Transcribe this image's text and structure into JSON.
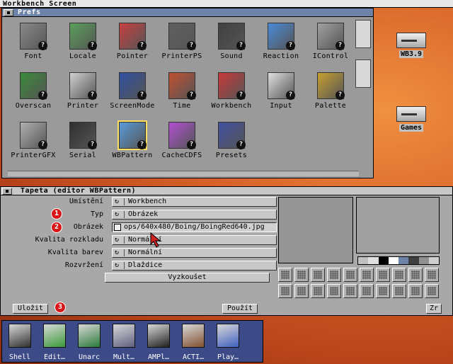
{
  "screen": {
    "title": "Workbench Screen"
  },
  "prefs_window": {
    "title": "Prefs",
    "icons": [
      {
        "label": "Font",
        "icon": "font-icon"
      },
      {
        "label": "Locale",
        "icon": "locale-icon"
      },
      {
        "label": "Pointer",
        "icon": "pointer-icon"
      },
      {
        "label": "PrinterPS",
        "icon": "printerps-icon"
      },
      {
        "label": "Sound",
        "icon": "sound-icon"
      },
      {
        "label": "Reaction",
        "icon": "reaction-icon"
      },
      {
        "label": "IControl",
        "icon": "icontrol-icon"
      },
      {
        "label": "Overscan",
        "icon": "overscan-icon"
      },
      {
        "label": "Printer",
        "icon": "printer-icon"
      },
      {
        "label": "ScreenMode",
        "icon": "screenmode-icon"
      },
      {
        "label": "Time",
        "icon": "time-icon"
      },
      {
        "label": "Workbench",
        "icon": "workbench-icon"
      },
      {
        "label": "Input",
        "icon": "input-icon"
      },
      {
        "label": "Palette",
        "icon": "palette-icon"
      },
      {
        "label": "PrinterGFX",
        "icon": "printergfx-icon"
      },
      {
        "label": "Serial",
        "icon": "serial-icon"
      },
      {
        "label": "WBPattern",
        "icon": "wbpattern-icon",
        "selected": true
      },
      {
        "label": "CacheCDFS",
        "icon": "cachecdfs-icon"
      },
      {
        "label": "Presets",
        "icon": "presets-icon"
      }
    ]
  },
  "desktop": {
    "icons": [
      {
        "label": "WB3.9",
        "icon": "disk-drive-icon"
      },
      {
        "label": "Games",
        "icon": "disk-drive-icon"
      }
    ]
  },
  "editor": {
    "title": "Tapeta (editor WBPattern)",
    "fields": {
      "placement": {
        "label": "Umístění",
        "value": "Workbench"
      },
      "type": {
        "label": "Typ",
        "value": "Obrázek"
      },
      "image": {
        "label": "Obrázek",
        "value": "ops/640x480/Boing/BoingRed640.jpg"
      },
      "render_quality": {
        "label": "Kvalita rozkladu",
        "value": "Normální"
      },
      "color_quality": {
        "label": "Kvalita barev",
        "value": "Normální"
      },
      "layout": {
        "label": "Rozvržení",
        "value": "Dlaždice"
      }
    },
    "buttons": {
      "test": "Vyzkoušet",
      "save": "Uložit",
      "use": "Použít",
      "cancel": "Zr"
    },
    "badges": [
      "1",
      "2",
      "3"
    ],
    "palette_colors": [
      "#c0c0c0",
      "#e0e0e0",
      "#000000",
      "#ffffff",
      "#6d84a8",
      "#404040",
      "#909090",
      "#d0d0d0"
    ]
  },
  "dock": {
    "items": [
      {
        "label": "Shell",
        "icon": "shell-icon"
      },
      {
        "label": "Edit…",
        "icon": "edit-icon"
      },
      {
        "label": "Unarc",
        "icon": "unarc-icon"
      },
      {
        "label": "Mult…",
        "icon": "multiview-icon"
      },
      {
        "label": "AMPl…",
        "icon": "amplifier-icon"
      },
      {
        "label": "ACTI…",
        "icon": "activity-icon"
      },
      {
        "label": "Play…",
        "icon": "play-icon"
      }
    ]
  }
}
